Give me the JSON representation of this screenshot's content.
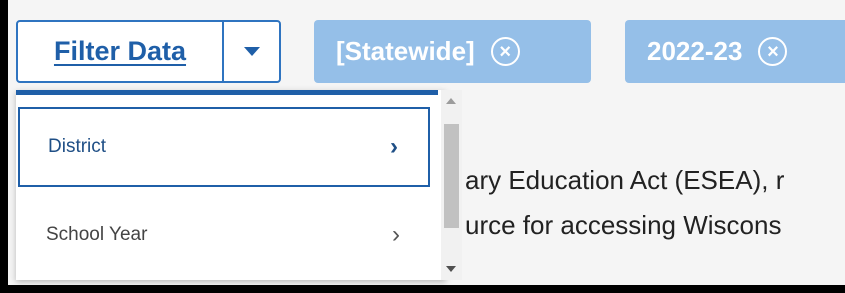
{
  "filter": {
    "label": "Filter Data",
    "dropdown_icon": "caret-down-icon"
  },
  "chips": [
    {
      "label": "[Statewide]",
      "close_symbol": "×"
    },
    {
      "label": "2022-23",
      "close_symbol": "×"
    }
  ],
  "dropdown": {
    "items": [
      {
        "label": "District",
        "chevron": "›"
      },
      {
        "label": "School Year",
        "chevron": "›"
      }
    ]
  },
  "background": {
    "line1": "ary Education Act (ESEA), r",
    "line2": "urce for accessing Wiscons"
  },
  "colors": {
    "accent": "#1f5fa8",
    "chip": "#95bfe8"
  }
}
